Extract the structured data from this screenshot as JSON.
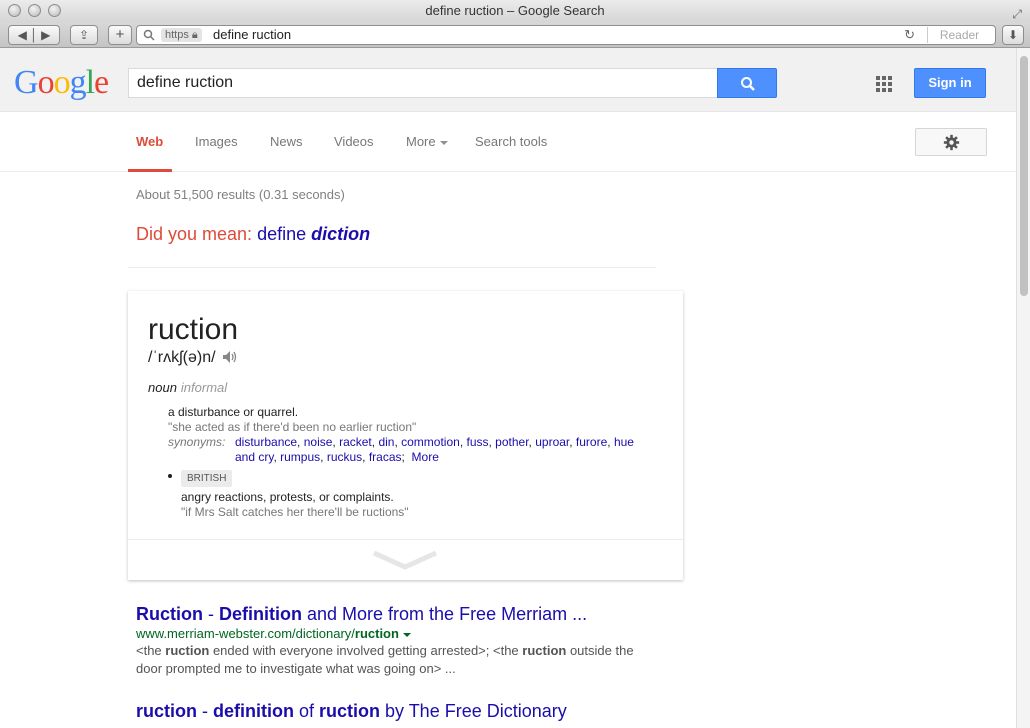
{
  "window": {
    "title": "define ruction – Google Search"
  },
  "browser": {
    "https_label": "https",
    "url": "define ruction",
    "reader_label": "Reader"
  },
  "header": {
    "query": "define ruction",
    "sign_in_label": "Sign in"
  },
  "tabs": [
    {
      "label": "Web",
      "active": true
    },
    {
      "label": "Images"
    },
    {
      "label": "News"
    },
    {
      "label": "Videos"
    },
    {
      "label": "More"
    },
    {
      "label": "Search tools"
    }
  ],
  "results_stats": "About 51,500 results (0.31 seconds)",
  "did_you_mean": {
    "label": "Did you mean:",
    "prefix": "define",
    "suggestion": "diction"
  },
  "dictionary": {
    "word": "ruction",
    "phonetic": "/ˈrʌkʃ(ə)n/",
    "part_of_speech": "noun",
    "register": "informal",
    "sense1": {
      "definition": "a disturbance or quarrel.",
      "example": "\"she acted as if there'd been no earlier ruction\"",
      "synonyms_label": "synonyms:",
      "synonyms": [
        "disturbance",
        "noise",
        "racket",
        "din",
        "commotion",
        "fuss",
        "pother",
        "uproar",
        "furore",
        "hue and cry",
        "rumpus",
        "ruckus",
        "fracas"
      ],
      "more_label": "More"
    },
    "sense2": {
      "region": "BRITISH",
      "definition": "angry reactions, protests, or complaints.",
      "example": "\"if Mrs Salt catches her there'll be ructions\""
    }
  },
  "results": [
    {
      "title_parts": [
        "Ruction",
        " - ",
        "Definition",
        " and More from the Free Merriam ..."
      ],
      "url_prefix": "www.merriam-webster.com/dictionary/",
      "url_bold": "ruction",
      "snippet": [
        "<the ",
        "ruction",
        " ended with everyone involved getting arrested>; <the ",
        "ruction",
        " outside the door prompted me to investigate what was going on> ..."
      ]
    },
    {
      "title_parts": [
        "ruction",
        " - ",
        "definition",
        " of ",
        "ruction",
        " by The Free Dictionary"
      ]
    }
  ],
  "colors": {
    "google_blue": "#4d90fe",
    "link": "#1a0dab",
    "url_green": "#006621",
    "active_red": "#dd4b39"
  }
}
